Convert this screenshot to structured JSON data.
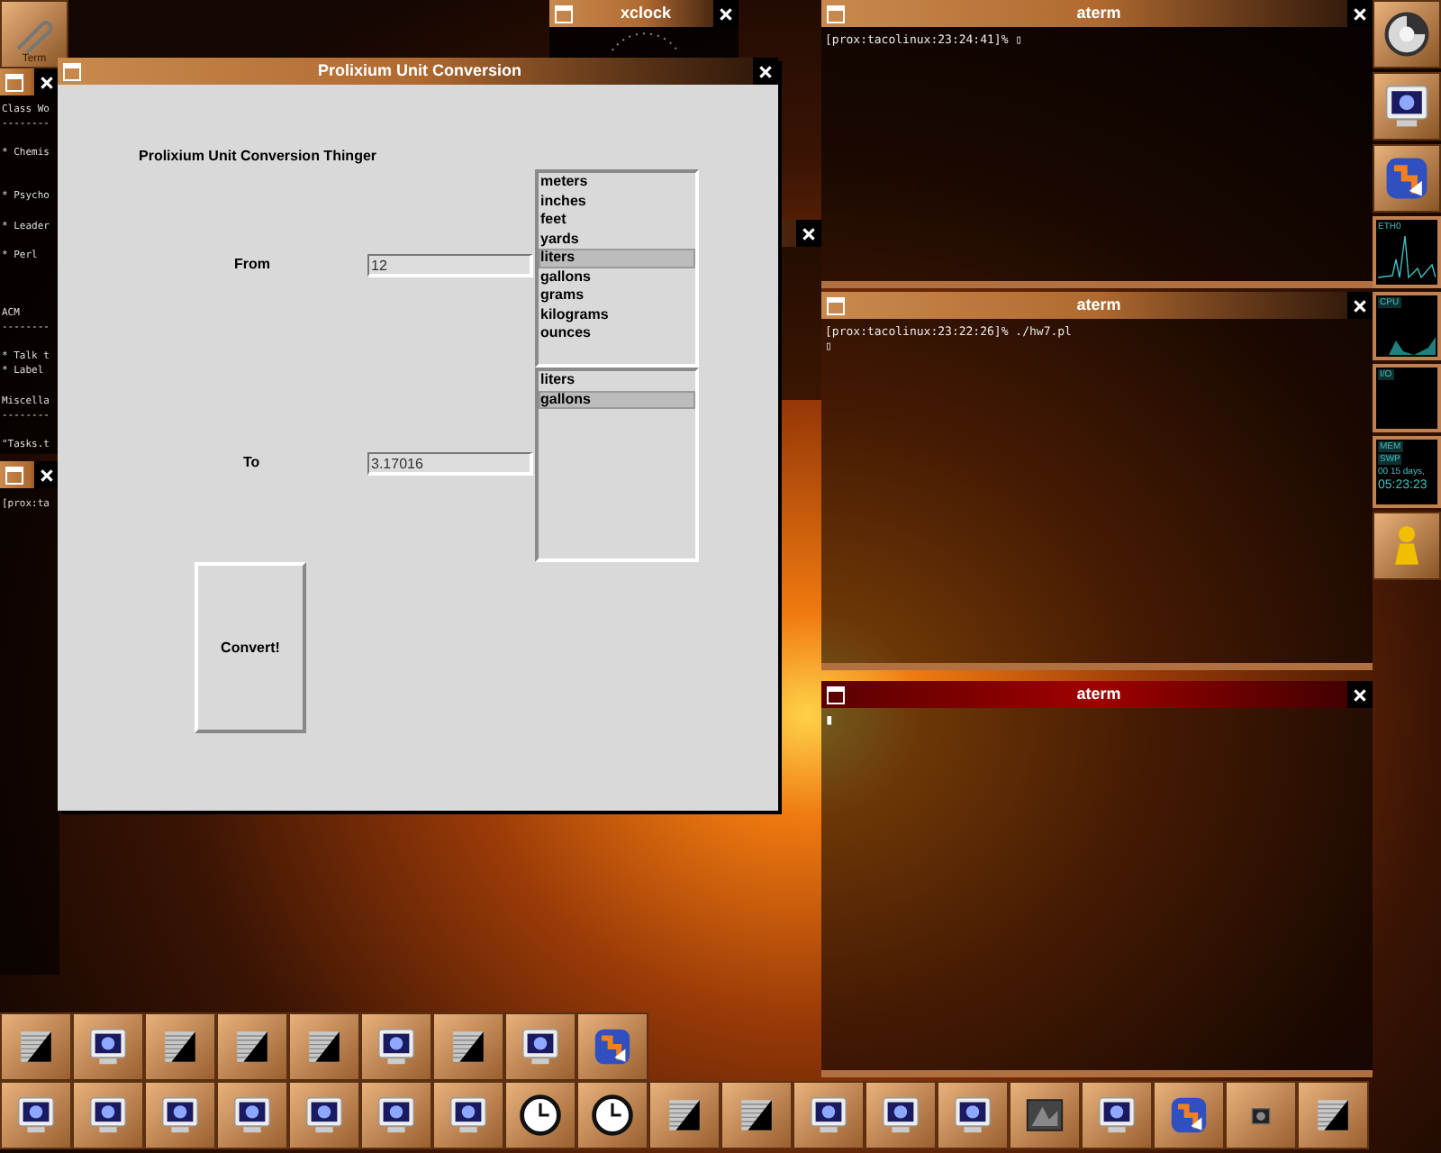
{
  "desktop_icon": {
    "label": "Term"
  },
  "left_terminal": {
    "lines": [
      "Class Wo",
      "--------",
      "* Chemis",
      "* Psycho",
      "* Leader",
      "* Perl",
      "ACM",
      "--------",
      "* Talk t",
      "* Label",
      "Miscella",
      "--------",
      "\"Tasks.t"
    ]
  },
  "left_terminal_2": {
    "lines": [
      "[prox:ta"
    ]
  },
  "xclock": {
    "title": "xclock"
  },
  "main_window": {
    "title": "Prolixium Unit Conversion",
    "heading": "Prolixium Unit Conversion Thinger",
    "from_label": "From",
    "from_value": "12",
    "to_label": "To",
    "to_value": "3.17016",
    "button": "Convert!",
    "from_units": [
      {
        "label": "meters",
        "selected": false
      },
      {
        "label": "inches",
        "selected": false
      },
      {
        "label": "feet",
        "selected": false
      },
      {
        "label": "yards",
        "selected": false
      },
      {
        "label": "liters",
        "selected": true
      },
      {
        "label": "gallons",
        "selected": false
      },
      {
        "label": "grams",
        "selected": false
      },
      {
        "label": "kilograms",
        "selected": false
      },
      {
        "label": "ounces",
        "selected": false
      }
    ],
    "to_units": [
      {
        "label": "liters",
        "selected": false
      },
      {
        "label": "gallons",
        "selected": true
      }
    ]
  },
  "terminals": [
    {
      "title": "aterm",
      "focused": false,
      "lines": [
        "[prox:tacolinux:23:24:41]% ▯"
      ]
    },
    {
      "title": "aterm",
      "focused": false,
      "lines": [
        "[prox:tacolinux:23:22:26]% ./hw7.pl",
        "▯"
      ]
    },
    {
      "title": "aterm",
      "focused": true,
      "lines": [
        "▮"
      ]
    }
  ],
  "dock": {
    "launchers": [
      {
        "kind": "disk"
      },
      {
        "kind": "monitor"
      },
      {
        "kind": "app"
      }
    ],
    "eth": "ETH0",
    "cpu": "CPU",
    "io": "I/O",
    "mem": "MEM",
    "swp": "SWP",
    "uptime": "00 15 days,",
    "time": "05:23:23",
    "bottom_launcher": {
      "kind": "person"
    }
  },
  "taskbar": [
    {
      "buttons": [
        {
          "kind": "terminal"
        },
        {
          "kind": "monitor"
        },
        {
          "kind": "terminal"
        },
        {
          "kind": "terminal"
        },
        {
          "kind": "terminal"
        },
        {
          "kind": "monitor"
        },
        {
          "kind": "terminal"
        },
        {
          "kind": "monitor"
        },
        {
          "kind": "app"
        }
      ]
    },
    {
      "buttons": [
        {
          "kind": "monitor"
        },
        {
          "kind": "monitor"
        },
        {
          "kind": "monitor"
        },
        {
          "kind": "monitor"
        },
        {
          "kind": "monitor"
        },
        {
          "kind": "monitor"
        },
        {
          "kind": "monitor"
        },
        {
          "kind": "clock"
        },
        {
          "kind": "clock"
        },
        {
          "kind": "terminal"
        },
        {
          "kind": "terminal"
        },
        {
          "kind": "monitor"
        },
        {
          "kind": "monitor"
        },
        {
          "kind": "monitor"
        },
        {
          "kind": "photo"
        },
        {
          "kind": "monitor"
        },
        {
          "kind": "app"
        },
        {
          "kind": "camera"
        },
        {
          "kind": "terminal"
        }
      ]
    }
  ]
}
